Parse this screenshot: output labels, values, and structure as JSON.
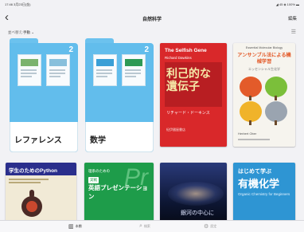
{
  "status_bar": {
    "time": "17:46",
    "date": "3月23日(金)",
    "right": "◢ 45 ◈ 100% ▬"
  },
  "nav": {
    "back_icon": "chevron-left-icon",
    "title": "自然科学",
    "edit_label": "編集"
  },
  "sort": {
    "label": "並べ替え:",
    "value": "手動 ⌄",
    "list_icon": "list-icon"
  },
  "folders": [
    {
      "name": "レファレンス",
      "count": "2",
      "band_colors": [
        "#7bb36e",
        "#88c0dc"
      ]
    },
    {
      "name": "数学",
      "count": "2",
      "band_colors": [
        "#3a9fd6",
        "#2e9a55"
      ]
    }
  ],
  "books": [
    {
      "title": "The Selfish Gene",
      "author": "Richard Dawkins",
      "jp_title": "利己的な遺伝子",
      "jp_author": "リチャード・ドーキンス",
      "publisher": "紀伊國屋書店",
      "colors": {
        "bg": "#d9282a",
        "text": "#f5e9a8"
      }
    },
    {
      "title": "Essential Molecular Biology",
      "jp_title": "エッセンシャル生化学",
      "subtitle": "アンサンブル法による機械学習",
      "author": "Herbert Ober",
      "colors": {
        "bg": "#f6f4ee",
        "accent": "#e35b2a"
      }
    },
    {
      "title": "学生のためのPython",
      "colors": {
        "bg": "#f1ead6"
      }
    },
    {
      "title": "英語プレゼンテーション",
      "prefix": "理系のための",
      "label": "実戦",
      "colors": {
        "bg": "#1e9c4a"
      }
    },
    {
      "title": "銀河の中心に",
      "colors": {
        "bg": "#0d1633"
      }
    },
    {
      "title": "有機化学",
      "prefix": "はじめて学ぶ",
      "english": "Organic Chemistry for Beginners",
      "colors": {
        "bg": "#2e95d3"
      }
    }
  ],
  "tabs": [
    {
      "label": "本棚",
      "icon": "library-icon",
      "active": true
    },
    {
      "label": "検索",
      "icon": "search-icon",
      "active": false
    },
    {
      "label": "設定",
      "icon": "gear-icon",
      "active": false
    }
  ]
}
